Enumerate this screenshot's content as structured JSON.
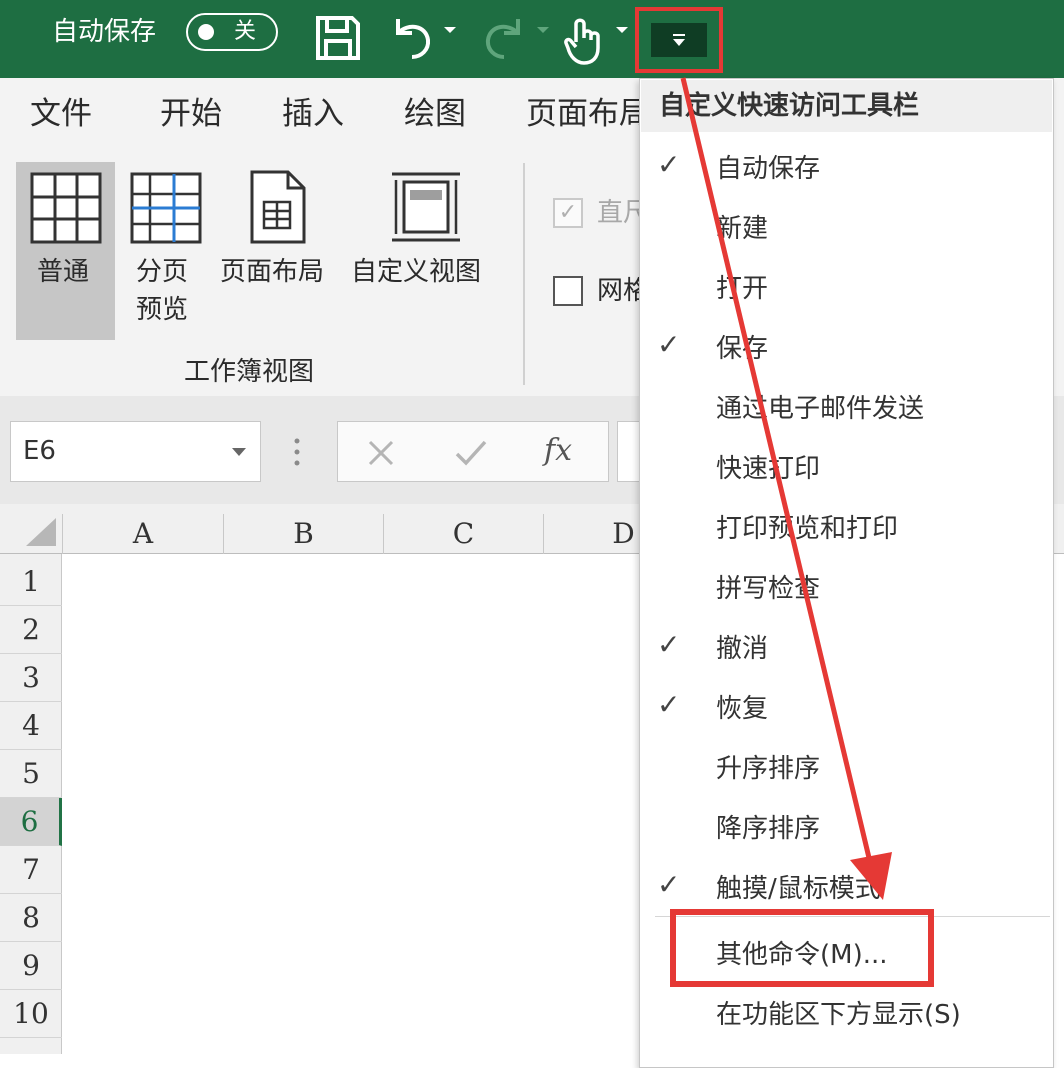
{
  "title_bar": {
    "autosave_label": "自动保存",
    "autosave_state": "关"
  },
  "ribbon_tabs": [
    "文件",
    "开始",
    "插入",
    "绘图",
    "页面布局"
  ],
  "ribbon": {
    "views": {
      "normal": "普通",
      "page_break_line1": "分页",
      "page_break_line2": "预览",
      "page_layout": "页面布局",
      "custom_views": "自定义视图"
    },
    "group_label": "工作簿视图",
    "ruler_label": "直尺",
    "gridlines_label": "网格线"
  },
  "formula_bar": {
    "name_box": "E6",
    "fx": "fx"
  },
  "grid": {
    "columns": [
      "A",
      "B",
      "C",
      "D"
    ],
    "rows": [
      "1",
      "2",
      "3",
      "4",
      "5",
      "6",
      "7",
      "8",
      "9",
      "10"
    ],
    "selected_row": "6"
  },
  "menu": {
    "title": "自定义快速访问工具栏",
    "items": [
      {
        "label": "自动保存",
        "checked": true
      },
      {
        "label": "新建",
        "checked": false
      },
      {
        "label": "打开",
        "checked": false
      },
      {
        "label": "保存",
        "checked": true
      },
      {
        "label": "通过电子邮件发送",
        "checked": false
      },
      {
        "label": "快速打印",
        "checked": false
      },
      {
        "label": "打印预览和打印",
        "checked": false
      },
      {
        "label": "拼写检查",
        "checked": false
      },
      {
        "label": "撤消",
        "checked": true
      },
      {
        "label": "恢复",
        "checked": true
      },
      {
        "label": "升序排序",
        "checked": false
      },
      {
        "label": "降序排序",
        "checked": false
      },
      {
        "label": "触摸/鼠标模式",
        "checked": true
      }
    ],
    "more_commands": "其他命令(M)...",
    "show_below": "在功能区下方显示(S)"
  },
  "colors": {
    "title_bar": "#1e6e42",
    "highlight": "#e53935",
    "ribbon_bg": "#f3f3f3"
  }
}
